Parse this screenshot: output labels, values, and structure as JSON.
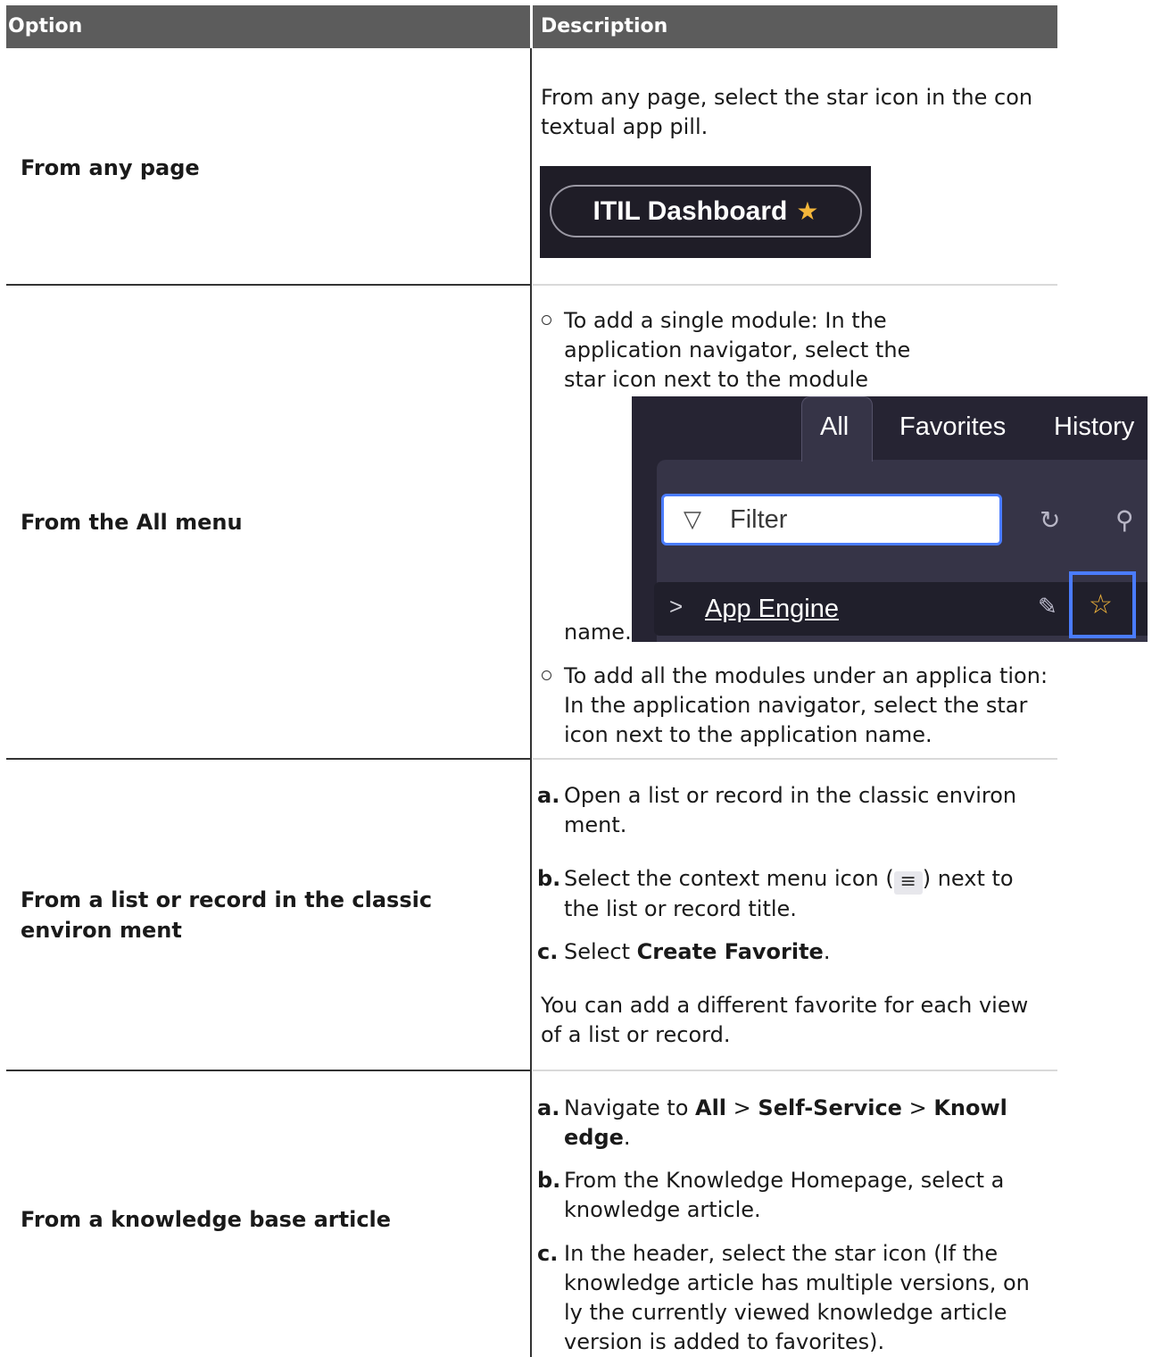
{
  "table": {
    "headers": {
      "option": "Option",
      "description": "Description"
    },
    "rows": [
      {
        "option": "From any page",
        "desc": "From any page, select the star icon in the con textual app pill.",
        "pill": {
          "label": "ITIL Dashboard",
          "star": "★",
          "colors": {
            "background": "#1f1d27",
            "star": "#f4b63a"
          }
        }
      },
      {
        "option": "From the All menu",
        "bullet1": "To add a single module: In the application navigator, select the star icon next to the module",
        "bullet1_tail": "name.",
        "navigator": {
          "tabs": [
            "All",
            "Favorites",
            "History"
          ],
          "filter_placeholder": "Filter",
          "filter_icon": "▽",
          "refresh_icon": "↻",
          "pin_icon": "⚲",
          "module_name": "App Engine",
          "chevron_icon": ">",
          "edit_icon": "✎",
          "star_icon": "☆",
          "highlight_color": "#4a7cff"
        },
        "bullet2": "To add all the modules under an applica tion: In the application navigator, select the star icon next to the application name."
      },
      {
        "option": "From a list or record in the classic environ ment",
        "steps": {
          "a": {
            "marker": "a.",
            "text": "Open a list or record in the classic environ ment."
          },
          "b": {
            "marker": "b.",
            "pre": "Select the context menu icon (",
            "icon": "≡",
            "post": ") next to the list or record title."
          },
          "c": {
            "marker": "c.",
            "pre": "Select ",
            "bold": "Create Favorite",
            "post": "."
          }
        },
        "note": "You can add a different favorite for each view of a list or record."
      },
      {
        "option": "From a knowledge base article",
        "steps": {
          "a": {
            "marker": "a.",
            "pre": "Navigate to ",
            "b1": "All",
            "sep1": " > ",
            "b2": "Self-Service",
            "sep2": " > ",
            "b3": "Knowl edge",
            "post": "."
          },
          "b": {
            "marker": "b.",
            "text": "From the Knowledge Homepage, select a knowledge article."
          },
          "c": {
            "marker": "c.",
            "text": "In the header, select the star icon (If the knowledge article has multiple versions, on ly the currently viewed knowledge article version is added to favorites)."
          }
        }
      }
    ]
  }
}
